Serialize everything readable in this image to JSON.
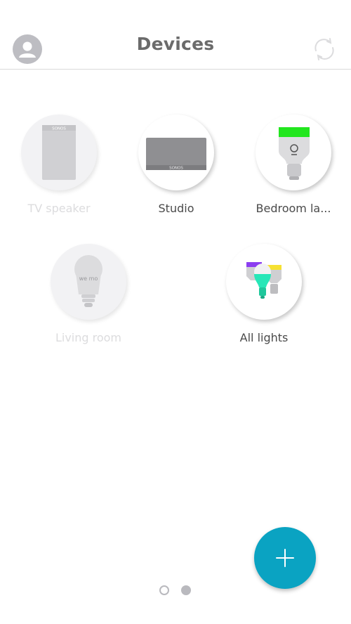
{
  "header": {
    "title": "Devices",
    "avatar_icon": "user-avatar-icon",
    "sync_icon": "sync-icon"
  },
  "devices": [
    {
      "label": "TV speaker",
      "icon": "sonos-one-speaker-icon",
      "brand_text": "SONOS",
      "state": "unavailable"
    },
    {
      "label": "Studio",
      "icon": "sonos-play3-speaker-icon",
      "brand_text": "SONOS",
      "state": "available"
    },
    {
      "label": "Bedroom la...",
      "icon": "led-bulb-icon",
      "state": "available"
    },
    {
      "label": "Living room",
      "icon": "wemo-bulb-icon",
      "brand_text": "we mo",
      "state": "unavailable"
    },
    {
      "label": "All lights",
      "icon": "multi-color-bulbs-icon",
      "state": "available"
    }
  ],
  "fab": {
    "icon": "plus-icon"
  },
  "pagination": {
    "pages": 2,
    "current": 2
  },
  "colors": {
    "accent": "#0aa3c2",
    "bulb_green": "#22e61e",
    "bulb_teal": "#27e7b8",
    "bulb_purple": "#8b3df0",
    "bulb_yellow": "#f6e132"
  }
}
